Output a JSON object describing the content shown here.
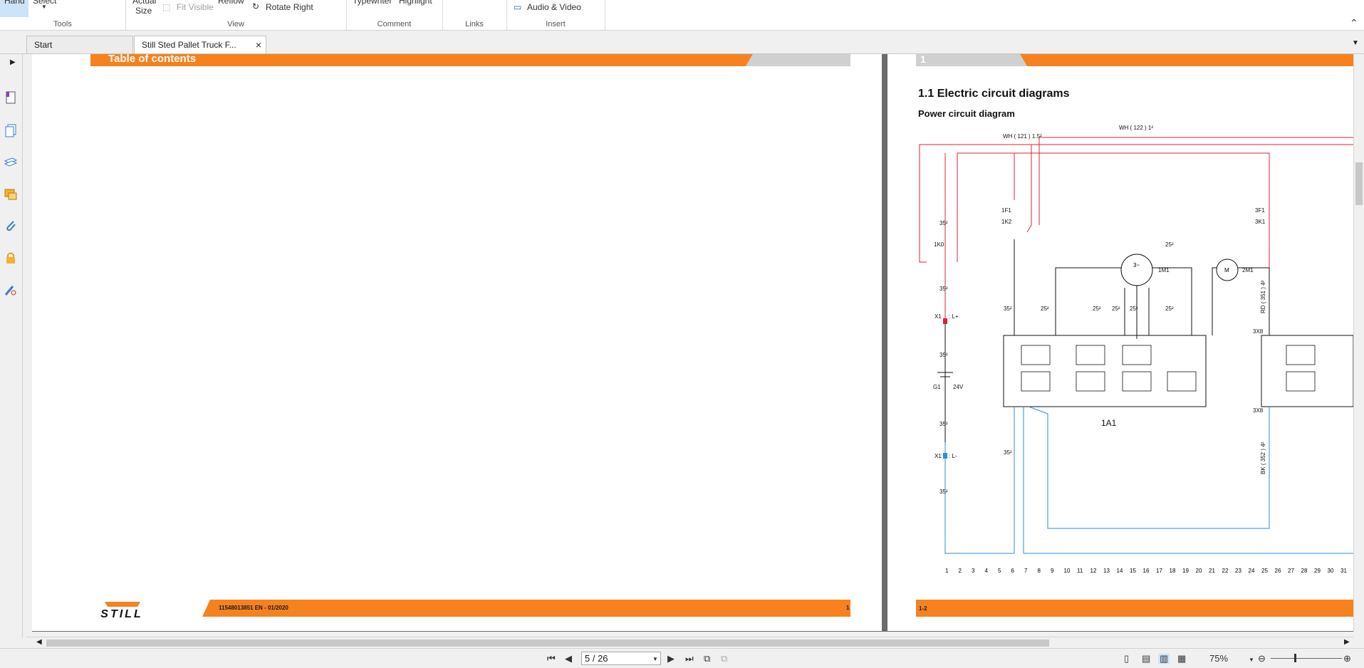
{
  "ribbon": {
    "tools": {
      "label": "Tools",
      "hand": "Hand",
      "select": "Select"
    },
    "view": {
      "label": "View",
      "actual": "Actual",
      "size": "Size",
      "fit_visible": "Fit Visible",
      "reflow": "Reflow",
      "rotate_right": "Rotate Right"
    },
    "comment": {
      "label": "Comment",
      "typewriter": "Typewriter",
      "highlight": "Highlight"
    },
    "links": {
      "label": "Links"
    },
    "insert": {
      "label": "Insert",
      "audio_video": "Audio & Video"
    }
  },
  "tabs": [
    {
      "label": "Start"
    },
    {
      "label": "Still Sted Pallet Truck F..."
    }
  ],
  "page_left": {
    "header": "Table of contents",
    "footer_doc": "11548013851 EN - 01/2020",
    "footer_page": "1",
    "logo": "STILL"
  },
  "page_right": {
    "header_num": "1",
    "section": "1.1  Electric circuit diagrams",
    "subtitle": "Power circuit diagram",
    "footer_page": "1-2"
  },
  "diagram": {
    "wire_wh121": "WH ( 121 ) 1.5²",
    "wire_wh122": "WH ( 122 ) 1²",
    "rd351": "RD ( 351 ) 4²",
    "bk352": "BK ( 352 ) 4²",
    "k0": "1K0",
    "x1_plus": "X1",
    "l_plus": ": L+",
    "x1_minus": "X1",
    "l_minus": ": L-",
    "g1": "G1",
    "v24": "24V",
    "f1": "1F1",
    "k2": "1K2",
    "f3": "3F1",
    "k3": "3K1",
    "m1": "1M1",
    "m2": "2M1",
    "a1": "1A1",
    "x8a": "3X8",
    "x8b": "3X8",
    "w35": "35²",
    "w25": "25²",
    "ruler": [
      "1",
      "2",
      "3",
      "4",
      "5",
      "6",
      "7",
      "8",
      "9",
      "10",
      "11",
      "12",
      "13",
      "14",
      "15",
      "16",
      "17",
      "18",
      "19",
      "20",
      "21",
      "22",
      "23",
      "24",
      "25",
      "26",
      "27",
      "28",
      "29",
      "30",
      "31"
    ]
  },
  "status": {
    "page_input": "5 / 26",
    "zoom": "75%"
  },
  "colors": {
    "orange": "#f5821f",
    "red_wire": "#e0203a",
    "blue_wire": "#2a8fd6",
    "select_blue": "#cde3f7"
  }
}
